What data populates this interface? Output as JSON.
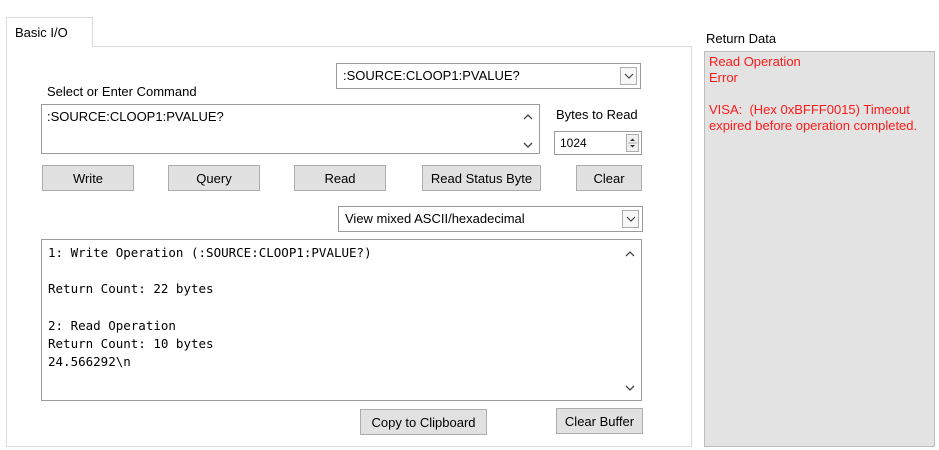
{
  "tab": {
    "label": "Basic I/O"
  },
  "command": {
    "label": "Select or Enter Command",
    "dropdown_value": ":SOURCE:CLOOP1:PVALUE?",
    "input_value": ":SOURCE:CLOOP1:PVALUE?"
  },
  "bytes_to_read": {
    "label": "Bytes to Read",
    "value": "1024"
  },
  "buttons": {
    "write": "Write",
    "query": "Query",
    "read": "Read",
    "read_status_byte": "Read Status Byte",
    "clear": "Clear",
    "copy_to_clipboard": "Copy to Clipboard",
    "clear_buffer": "Clear Buffer"
  },
  "view_mode": {
    "value": "View mixed ASCII/hexadecimal"
  },
  "output": {
    "lines": [
      "1: Write Operation (:SOURCE:CLOOP1:PVALUE?)",
      "",
      "Return Count: 22 bytes",
      "",
      "2: Read Operation",
      "Return Count: 10 bytes",
      "24.566292\\n"
    ]
  },
  "return_data": {
    "label": "Return Data",
    "line1": "Read Operation",
    "line2": "Error",
    "line3": "",
    "message": "VISA:  (Hex 0xBFFF0015) Timeout expired before operation completed."
  },
  "colors": {
    "error_text": "#ff1a1a",
    "return_bg": "#e3e3e3",
    "button_bg": "#e1e1e1"
  }
}
